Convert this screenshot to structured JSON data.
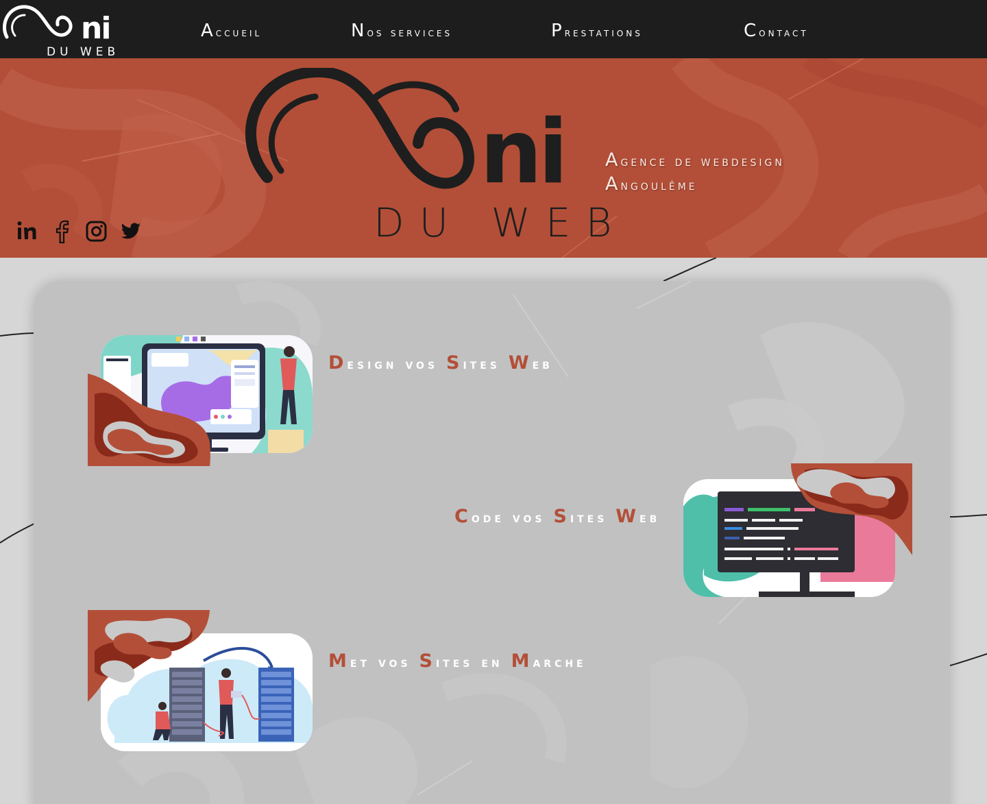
{
  "brand": {
    "logo_main": "ni",
    "logo_sub": "DU WEB",
    "hero_logo_main": "ni",
    "hero_logo_sub": "DU WEB"
  },
  "nav": {
    "items": [
      {
        "label": "Accueil"
      },
      {
        "label": "Nos services"
      },
      {
        "label": "Prestations"
      },
      {
        "label": "Contact"
      }
    ]
  },
  "hero": {
    "tagline_line1": "Agence de webdesign",
    "tagline_line2": "Angoulême"
  },
  "social": {
    "icons": [
      "linkedin-icon",
      "facebook-icon",
      "instagram-icon",
      "twitter-icon"
    ]
  },
  "services": [
    {
      "parts": [
        {
          "cap": "D",
          "rest": "esign vos "
        },
        {
          "cap": "S",
          "rest": "ites "
        },
        {
          "cap": "W",
          "rest": "eb"
        }
      ]
    },
    {
      "parts": [
        {
          "cap": "C",
          "rest": "ode vos "
        },
        {
          "cap": "S",
          "rest": "ites "
        },
        {
          "cap": "W",
          "rest": "eb"
        }
      ]
    },
    {
      "parts": [
        {
          "cap": "M",
          "rest": "et vos "
        },
        {
          "cap": "S",
          "rest": "ites en "
        },
        {
          "cap": "M",
          "rest": "arche"
        }
      ]
    }
  ],
  "colors": {
    "nav_bg": "#1d1d1d",
    "hero_bg": "#b34f38",
    "accent": "#b34f38",
    "page_bg": "#d6d6d6",
    "panel_bg": "#c1c1c1",
    "logo_dark": "#1e1e1e"
  }
}
